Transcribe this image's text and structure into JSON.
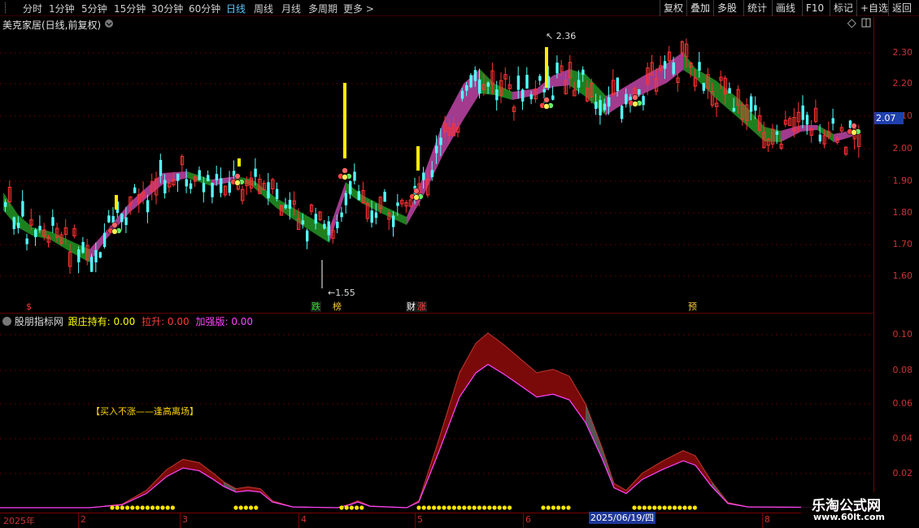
{
  "toolbar": {
    "timeframes": [
      "分时",
      "1分钟",
      "5分钟",
      "15分钟",
      "30分钟",
      "60分钟",
      "日线",
      "周线",
      "月线",
      "多周期",
      "更多"
    ],
    "active": "日线",
    "right_buttons": [
      "复权",
      "叠加",
      "多股",
      "统计",
      "画线",
      "F10",
      "标记",
      "+自选",
      "返回"
    ]
  },
  "stock": {
    "title": "美克家居(日线,前复权)"
  },
  "price_axis": [
    "2.30",
    "2.20",
    "2.10",
    "2.00",
    "1.90",
    "1.80",
    "1.70",
    "1.60"
  ],
  "last_price": "2.07",
  "high_label": "2.36",
  "low_label": "1.55",
  "signals": [
    {
      "text": "$",
      "color": "#ff3b3b"
    },
    {
      "text": "跌",
      "color": "#33dd33"
    },
    {
      "text": "榜",
      "color": "#ffcc33"
    },
    {
      "text": "财",
      "color": "#ffffff"
    },
    {
      "text": "涨",
      "color": "#ff4444"
    },
    {
      "text": "预",
      "color": "#ffcc33"
    }
  ],
  "indicator": {
    "name": "股朋指标网",
    "fields": [
      {
        "label": "跟庄持有: 0.00",
        "color": "#ffff00"
      },
      {
        "label": "拉升: 0.00",
        "color": "#ff3b3b"
      },
      {
        "label": "加强版: 0.00",
        "color": "#ff44ff"
      }
    ],
    "axis": [
      "0.10",
      "0.08",
      "0.06",
      "0.04",
      "0.02"
    ],
    "note": "【买入不涨——逢高离场】"
  },
  "date_axis": [
    "2025年",
    "2",
    "3",
    "4",
    "5",
    "6",
    "8"
  ],
  "cursor_date": "2025/06/19/四",
  "watermark": {
    "line1": "乐淘公式网",
    "line2": "www.60lt.com"
  },
  "colors": {
    "up": "#ff3333",
    "down": "#54ffff",
    "band_up": "#a23a8e",
    "band_down": "#1e7f1e",
    "ind_fill": "#7a0a0a",
    "ind_fill_grey": "#555555"
  },
  "chart_data": {
    "type": "candlestick",
    "price_ylim": [
      1.55,
      2.36
    ],
    "indicator_ylim": [
      0,
      0.1
    ]
  }
}
